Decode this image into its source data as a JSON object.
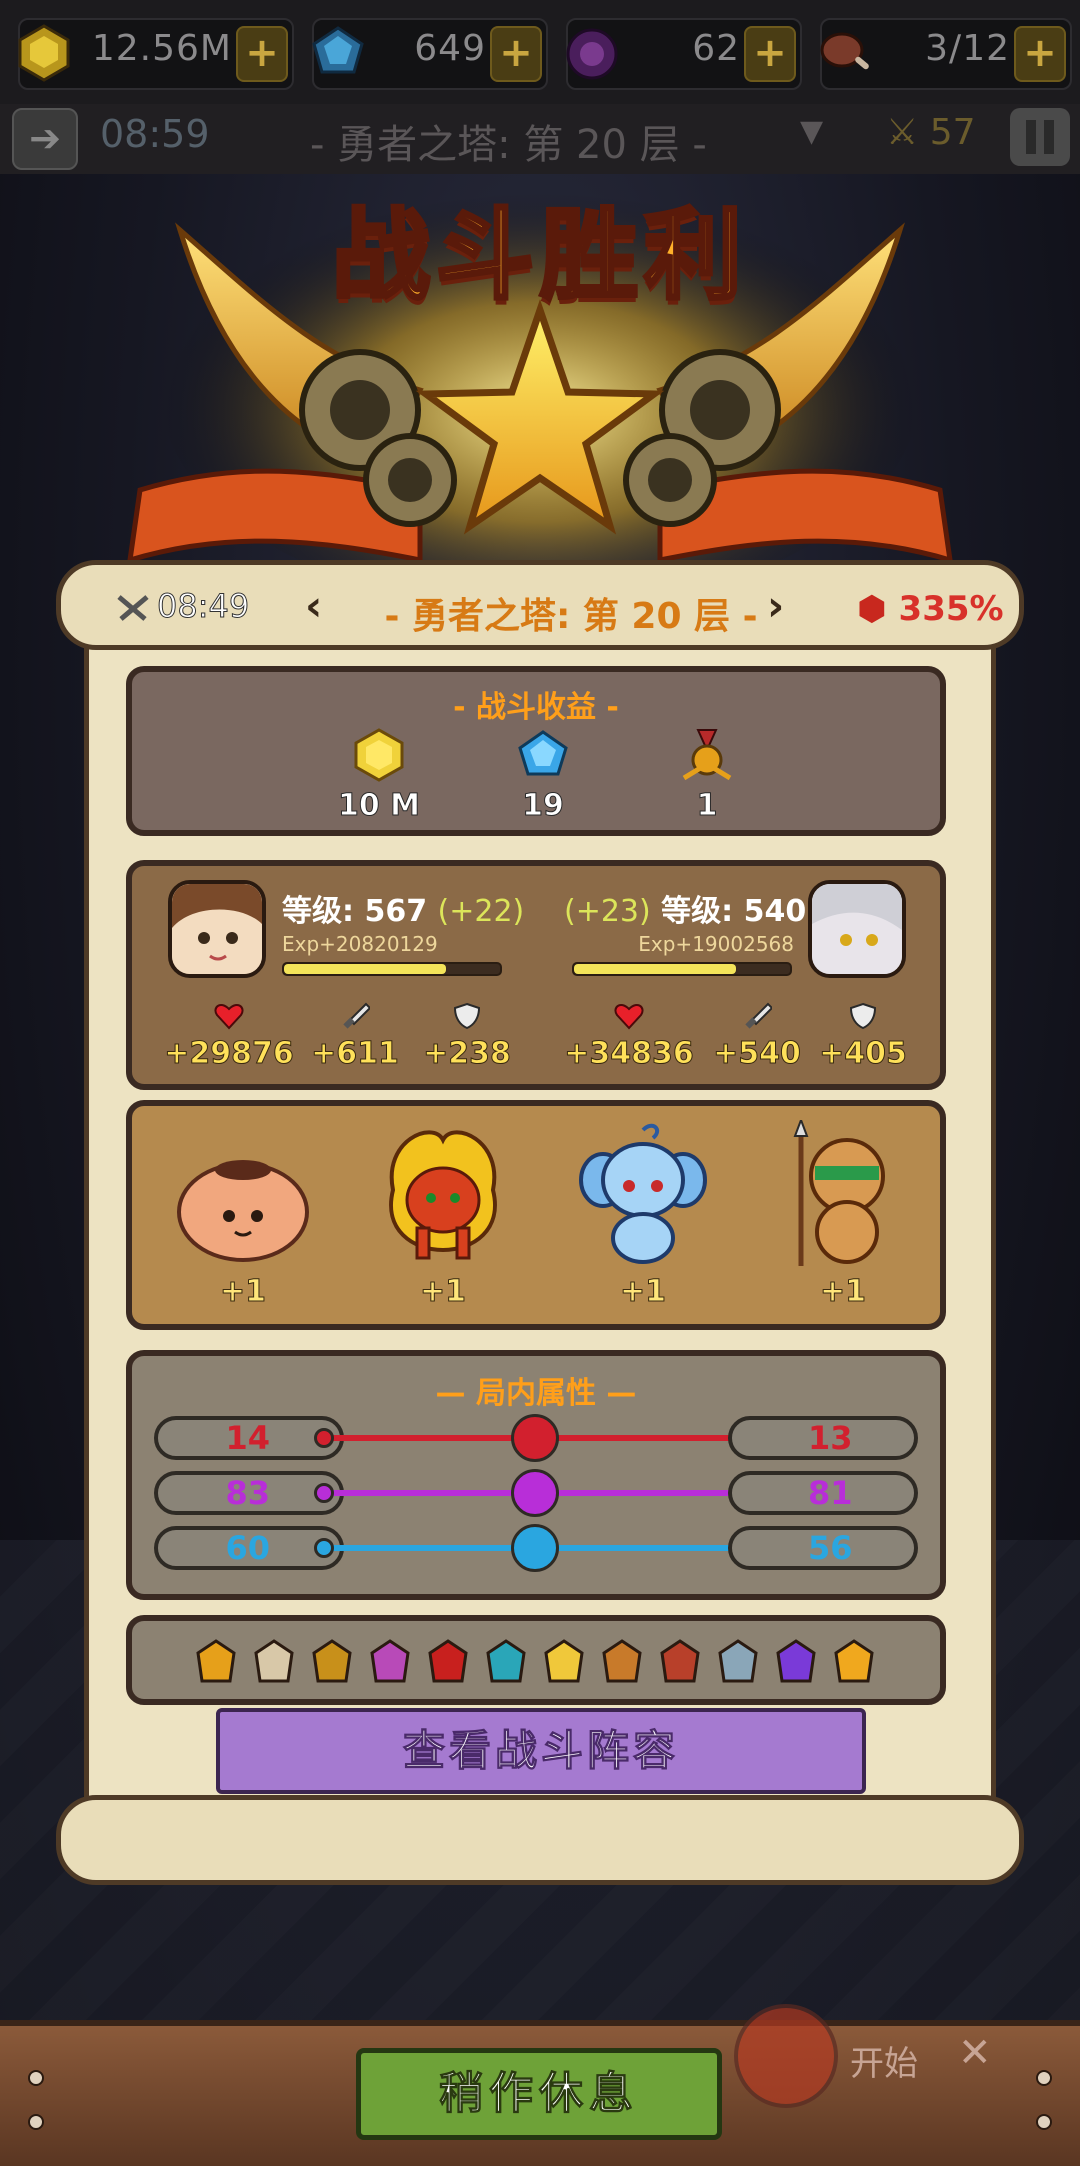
{
  "topbar": {
    "gold": "12.56M",
    "gems": "649",
    "orbs": "62",
    "stamina": "3/12",
    "timer": "08:59",
    "title": "- 勇者之塔: 第 20 层 -",
    "power": "57"
  },
  "banner": {
    "title": "战斗胜利"
  },
  "scroll_header": {
    "timer": "08:49",
    "title": "- 勇者之塔: 第 20 层 -",
    "power": "335%",
    "arrow_left": "‹",
    "arrow_right": "›"
  },
  "earnings": {
    "title": "- 战斗收益 -",
    "items": [
      {
        "icon": "gold-coin-icon",
        "value": "10 M"
      },
      {
        "icon": "blue-gem-icon",
        "value": "19"
      },
      {
        "icon": "medal-icon",
        "value": "1"
      }
    ]
  },
  "team": {
    "left": {
      "level": "等级: 567",
      "gain": "(+22)",
      "exp": "Exp+20820129",
      "exp_fill": 0.75,
      "hp": "+29876",
      "atk": "+611",
      "def": "+238"
    },
    "right": {
      "level": "等级: 540",
      "gain": "(+23)",
      "exp": "Exp+19002568",
      "exp_fill": 0.75,
      "hp": "+34836",
      "atk": "+540",
      "def": "+405"
    }
  },
  "pets": [
    {
      "name": "jar-pet",
      "value": "+1"
    },
    {
      "name": "fire-lion-pet",
      "value": "+1"
    },
    {
      "name": "blue-puppy-pet",
      "value": "+1"
    },
    {
      "name": "monkey-warrior-pet",
      "value": "+1"
    }
  ],
  "attributes": {
    "title": "— 局内属性 —",
    "rows": [
      {
        "left": "14",
        "right": "13",
        "color": "#d2202e",
        "icon": "fist-icon"
      },
      {
        "left": "83",
        "right": "81",
        "color": "#b82ed8",
        "icon": "boot-icon"
      },
      {
        "left": "60",
        "right": "56",
        "color": "#2aa6e0",
        "icon": "shield-icon"
      }
    ]
  },
  "items": [
    "leaf-icon",
    "feather-icon",
    "crown-icon",
    "scroll-icon",
    "cube-icon",
    "gear-gem-icon",
    "card-icon",
    "statue-icon",
    "compass-icon",
    "banner-icon",
    "orb-icon",
    "crystal-icon"
  ],
  "buttons": {
    "view_lineup": "查看战斗阵容",
    "rest": "稍作休息",
    "start": "开始",
    "close": "✕"
  }
}
